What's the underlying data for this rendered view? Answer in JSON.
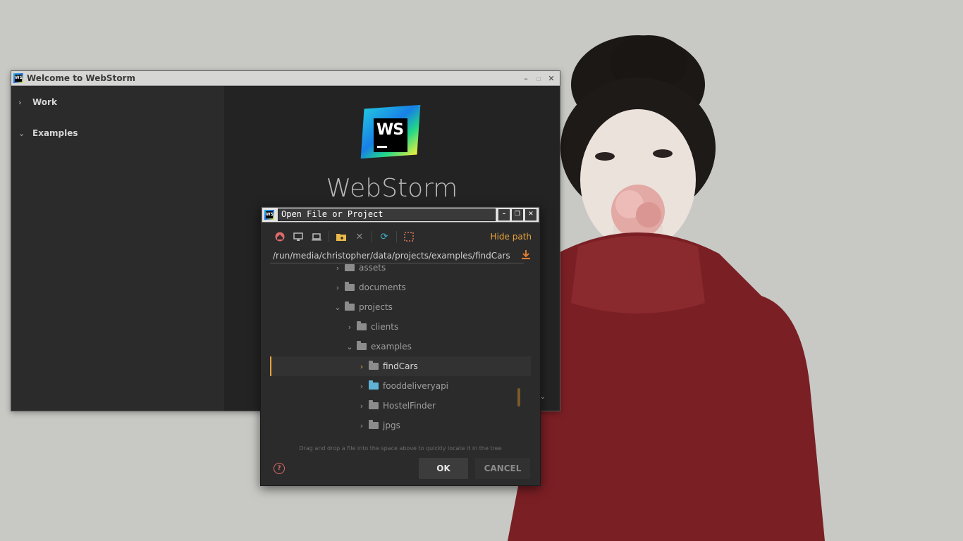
{
  "welcome_window": {
    "title": "Welcome to WebStorm",
    "groups": [
      {
        "label": "Work"
      },
      {
        "label": "Examples"
      }
    ],
    "app_name": "WebStorm",
    "logo_text": "WS"
  },
  "open_dialog": {
    "title": "Open File or Project",
    "hide_path_label": "Hide path",
    "path_value": "/run/media/christopher/data/projects/examples/findCars",
    "tree": [
      {
        "label": "assets",
        "expanded": false
      },
      {
        "label": "documents",
        "expanded": false
      },
      {
        "label": "projects",
        "expanded": true
      },
      {
        "label": "clients",
        "expanded": false
      },
      {
        "label": "examples",
        "expanded": true
      },
      {
        "label": "findCars",
        "expanded": false,
        "selected": true
      },
      {
        "label": "fooddeliveryapi",
        "expanded": false,
        "module": true
      },
      {
        "label": "HostelFinder",
        "expanded": false
      },
      {
        "label": "jpgs",
        "expanded": false
      }
    ],
    "hint": "Drag and drop a file into the space above to quickly locate it in the tree",
    "ok_label": "OK",
    "cancel_label": "CANCEL",
    "help_glyph": "?"
  },
  "icons": {
    "home": "home-icon",
    "desktop": "desktop-icon",
    "laptop": "laptop-icon",
    "new_folder": "new-folder-icon",
    "delete": "delete-icon",
    "refresh": "refresh-icon",
    "select": "select-region-icon",
    "download": "download-icon"
  },
  "colors": {
    "accent": "#e8a33c",
    "dialog_bg": "#2b2b2b",
    "module_folder": "#5fb3d4"
  }
}
